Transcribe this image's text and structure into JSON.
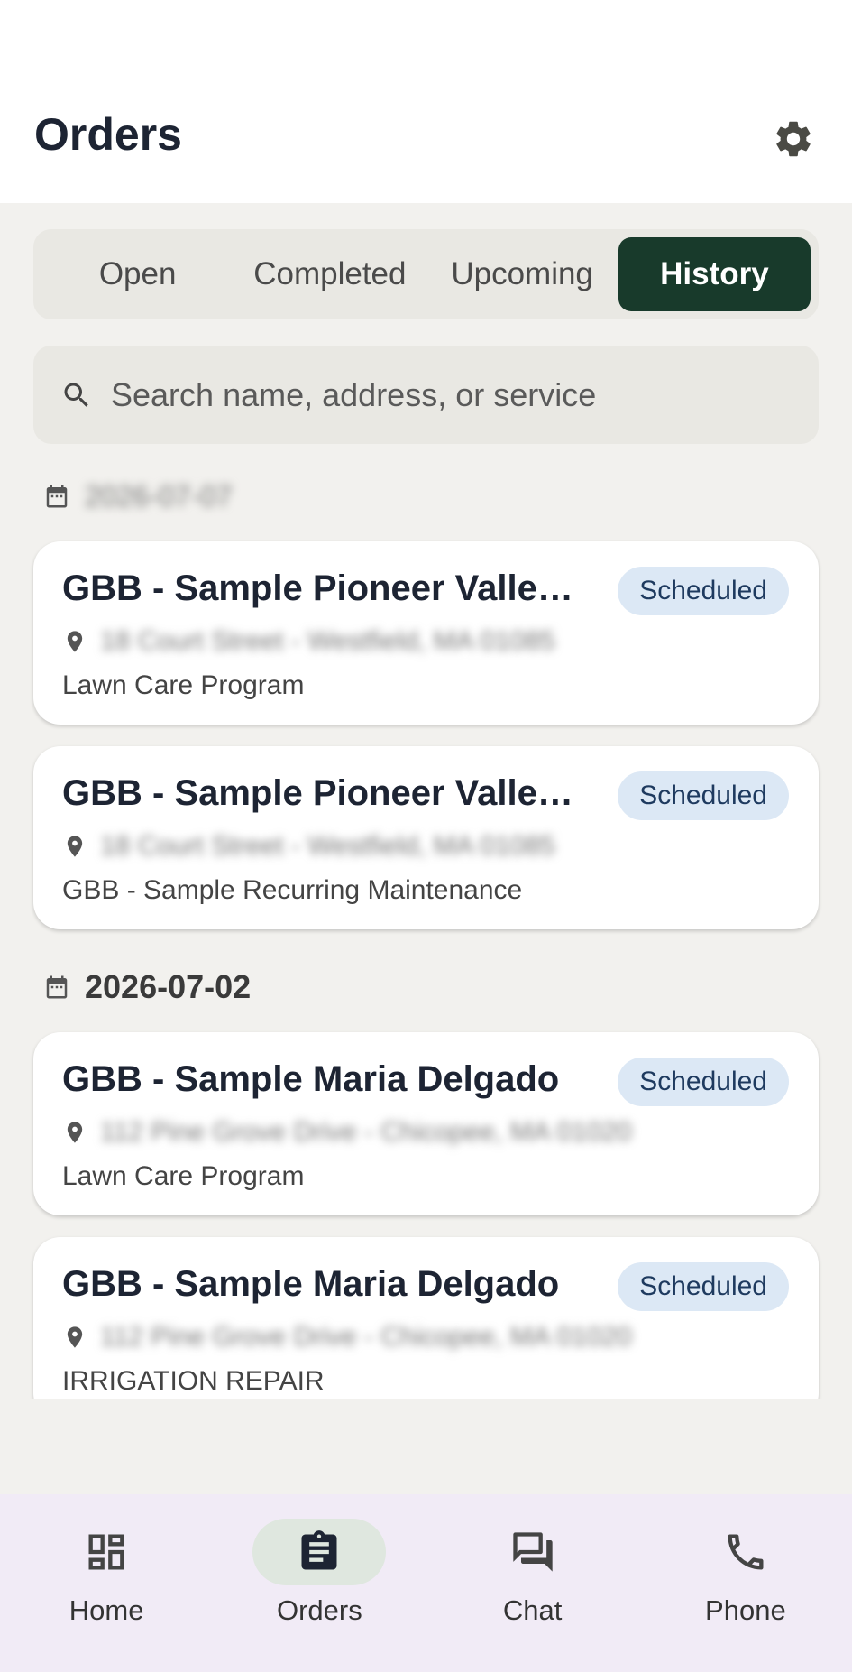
{
  "header": {
    "title": "Orders"
  },
  "tabs": [
    {
      "label": "Open",
      "active": false
    },
    {
      "label": "Completed",
      "active": false
    },
    {
      "label": "Upcoming",
      "active": false
    },
    {
      "label": "History",
      "active": true
    }
  ],
  "search": {
    "placeholder": "Search name, address, or service"
  },
  "groups": [
    {
      "date": "2026-07-07",
      "orders": [
        {
          "title": "GBB - Sample Pioneer Valley D...",
          "status": "Scheduled",
          "address": "18 Court Street - Westfield, MA 01085",
          "service": "Lawn Care Program"
        },
        {
          "title": "GBB - Sample Pioneer Valley D...",
          "status": "Scheduled",
          "address": "18 Court Street - Westfield, MA 01085",
          "service": "GBB - Sample Recurring Maintenance"
        }
      ]
    },
    {
      "date": "2026-07-02",
      "orders": [
        {
          "title": "GBB - Sample Maria Delgado",
          "status": "Scheduled",
          "address": "112 Pine Grove Drive - Chicopee, MA 01020",
          "service": "Lawn Care Program"
        },
        {
          "title": "GBB - Sample Maria Delgado",
          "status": "Scheduled",
          "address": "112 Pine Grove Drive - Chicopee, MA 01020",
          "service": "IRRIGATION REPAIR"
        }
      ]
    }
  ],
  "nav": [
    {
      "label": "Home",
      "icon": "dashboard-icon",
      "active": false
    },
    {
      "label": "Orders",
      "icon": "clipboard-icon",
      "active": true
    },
    {
      "label": "Chat",
      "icon": "chat-icon",
      "active": false
    },
    {
      "label": "Phone",
      "icon": "phone-icon",
      "active": false
    }
  ],
  "colors": {
    "accent": "#183a2b",
    "badge_bg": "#dce8f5",
    "badge_text": "#1e3a5f",
    "nav_bg": "#f1ebf6"
  }
}
